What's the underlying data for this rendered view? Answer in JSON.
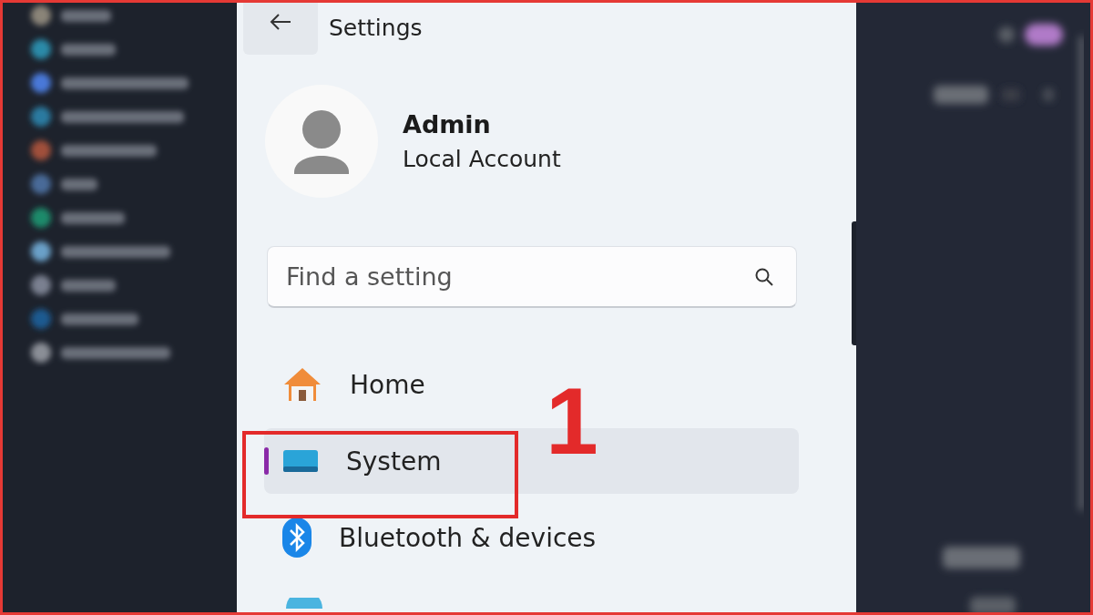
{
  "window": {
    "title": "Settings"
  },
  "profile": {
    "name": "Admin",
    "account": "Local Account"
  },
  "search": {
    "placeholder": "Find a setting"
  },
  "nav": [
    {
      "kind": "home",
      "label": "Home",
      "selected": false
    },
    {
      "kind": "system",
      "label": "System",
      "selected": true
    },
    {
      "kind": "bluetooth",
      "label": "Bluetooth & devices",
      "selected": false
    },
    {
      "kind": "network",
      "selected": false
    }
  ],
  "annotation": {
    "label": "1"
  }
}
